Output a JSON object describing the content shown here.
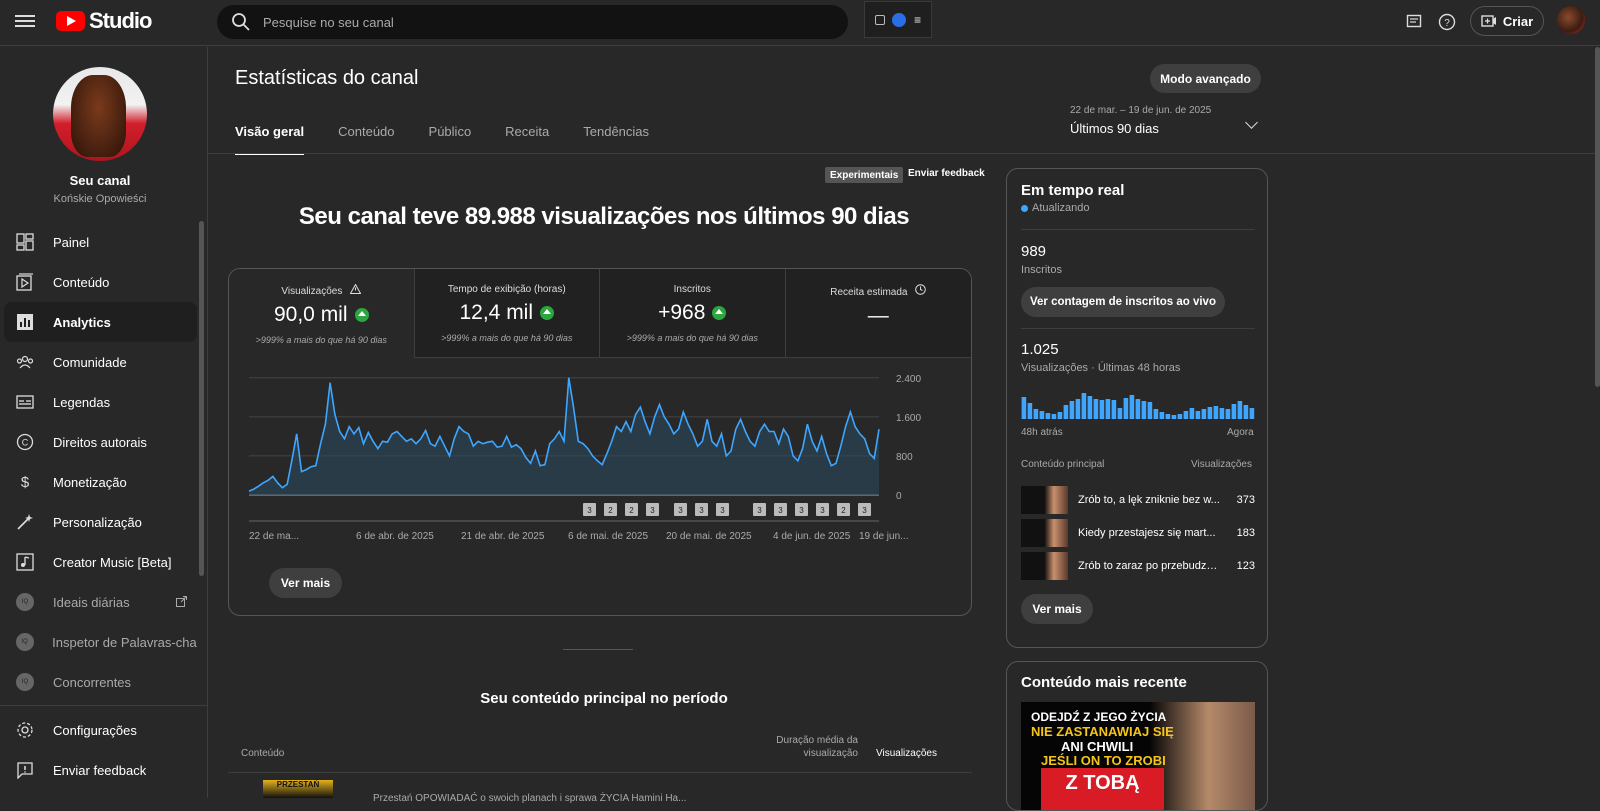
{
  "topbar": {
    "logo_text": "Studio",
    "search_placeholder": "Pesquise no seu canal",
    "create_label": "Criar"
  },
  "sidebar": {
    "channel_name": "Seu canal",
    "channel_handle": "Końskie Opowieści",
    "items": [
      {
        "label": "Painel",
        "icon": "dashboard-icon"
      },
      {
        "label": "Conteúdo",
        "icon": "content-icon"
      },
      {
        "label": "Analytics",
        "icon": "analytics-icon"
      },
      {
        "label": "Comunidade",
        "icon": "community-icon"
      },
      {
        "label": "Legendas",
        "icon": "subtitles-icon"
      },
      {
        "label": "Direitos autorais",
        "icon": "copyright-icon"
      },
      {
        "label": "Monetização",
        "icon": "dollar-icon"
      },
      {
        "label": "Personalização",
        "icon": "magic-wand-icon"
      },
      {
        "label": "Creator Music [Beta]",
        "icon": "music-icon"
      },
      {
        "label": "Ideais diárias",
        "icon": "extension-icon"
      },
      {
        "label": "Inspetor de Palavras-chav",
        "icon": "extension-icon"
      },
      {
        "label": "Concorrentes",
        "icon": "extension-icon"
      }
    ],
    "footer": [
      {
        "label": "Configurações",
        "icon": "gear-icon"
      },
      {
        "label": "Enviar feedback",
        "icon": "feedback-icon"
      }
    ]
  },
  "main": {
    "title": "Estatísticas do canal",
    "advanced_button": "Modo avançado",
    "tabs": [
      "Visão geral",
      "Conteúdo",
      "Público",
      "Receita",
      "Tendências"
    ],
    "period_range": "22 de mar. – 19 de jun. de 2025",
    "period_label": "Últimos 90 dias",
    "experimental_badge": "Experimentais",
    "feedback_link": "Enviar feedback",
    "headline": "Seu canal teve 89.988 visualizações nos últimos 90 dias",
    "metrics": [
      {
        "label": "Visualizações",
        "value": "90,0 mil",
        "comparison": ">999% a mais do que há 90 dias"
      },
      {
        "label": "Tempo de exibição (horas)",
        "value": "12,4 mil",
        "comparison": ">999% a mais do que há 90 dias"
      },
      {
        "label": "Inscritos",
        "value": "+968",
        "comparison": ">999% a mais do que há 90 dias"
      },
      {
        "label": "Receita estimada",
        "value": "—",
        "comparison": ""
      }
    ],
    "see_more": "Ver mais",
    "top_content_title": "Seu conteúdo principal no período",
    "table_headers": {
      "content": "Conteúdo",
      "avg_duration": "Duração média da visualização",
      "views": "Visualizações"
    },
    "first_row": {
      "thumb_text": "PRZESTAŃ",
      "title": "Przestań OPOWIADAĆ o swoich planach i sprawa ŻYCIA Hamini Ha..."
    }
  },
  "chart_data": {
    "type": "area",
    "x_tick_labels": [
      "22 de ma...",
      "6 de abr. de 2025",
      "21 de abr. de 2025",
      "6 de mai. de 2025",
      "20 de mai. de 2025",
      "4 de jun. de 2025",
      "19 de jun..."
    ],
    "y_ticks": [
      0,
      800,
      1600,
      2400
    ],
    "ylim": [
      0,
      2600
    ],
    "values": [
      80,
      120,
      180,
      250,
      300,
      380,
      250,
      150,
      220,
      720,
      1250,
      480,
      520,
      580,
      600,
      1050,
      1450,
      2300,
      1650,
      1300,
      1150,
      1400,
      1250,
      1380,
      1050,
      1280,
      1100,
      950,
      1100,
      1080,
      1250,
      1300,
      1200,
      1100,
      1150,
      1050,
      1150,
      1320,
      1050,
      1000,
      1200,
      1000,
      800,
      1150,
      1400,
      1300,
      1250,
      1000,
      1100,
      1050,
      1080,
      1100,
      980,
      1000,
      1200,
      980,
      1030,
      950,
      770,
      650,
      900,
      600,
      620,
      1050,
      1150,
      1300,
      1100,
      2400,
      1800,
      1100,
      1050,
      950,
      800,
      700,
      620,
      850,
      1100,
      1400,
      1300,
      1500,
      1300,
      1650,
      1800,
      1500,
      1250,
      1600,
      1850,
      1600,
      1450,
      1250,
      1350,
      1700,
      1450,
      1250,
      1000,
      1100,
      1550,
      1100,
      1000,
      1250,
      800,
      900,
      1350,
      1550,
      1300,
      1100,
      1000,
      1300,
      1450,
      1300,
      1300,
      1050,
      1350,
      1200,
      800,
      700,
      950,
      1450,
      1100,
      900,
      1200,
      850,
      600,
      650,
      1000,
      1400,
      1700,
      1400,
      1250,
      1150,
      850,
      750,
      1350
    ],
    "markers": [
      "3",
      "2",
      "2",
      "3",
      "3",
      "3",
      "3",
      "3",
      "3",
      "3",
      "3",
      "2",
      "3"
    ],
    "area_color": "#3ea6ff"
  },
  "realtime": {
    "title": "Em tempo real",
    "status": "Atualizando",
    "subscribers_value": "989",
    "subscribers_label": "Inscritos",
    "live_count_button": "Ver contagem de inscritos ao vivo",
    "views_value": "1.025",
    "views_label": "Visualizações · Últimas 48 horas",
    "bars": [
      22,
      16,
      10,
      8,
      6,
      5,
      7,
      14,
      18,
      20,
      26,
      23,
      20,
      19,
      20,
      19,
      11,
      21,
      24,
      20,
      18,
      17,
      10,
      7,
      5,
      4,
      5,
      8,
      11,
      8,
      10,
      12,
      13,
      11,
      10,
      15,
      18,
      14,
      11
    ],
    "axis_left": "48h atrás",
    "axis_right": "Agora",
    "top_content_label": "Conteúdo principal",
    "views_col_label": "Visualizações",
    "items": [
      {
        "title": "Zrób to, a lęk zniknie bez w...",
        "views": "373"
      },
      {
        "title": "Kiedy przestajesz się mart...",
        "views": "183"
      },
      {
        "title": "Zrób to zaraz po przebudze...",
        "views": "123"
      }
    ],
    "see_more": "Ver mais"
  },
  "recent": {
    "title": "Conteúdo mais recente",
    "thumb_lines": [
      "ODEJDŹ Z JEGO ŻYCIA",
      "NIE ZASTANAWIAJ SIĘ",
      "ANI CHWILI",
      "JEŚLI ON TO ZROBI",
      "Z TOBĄ"
    ]
  }
}
